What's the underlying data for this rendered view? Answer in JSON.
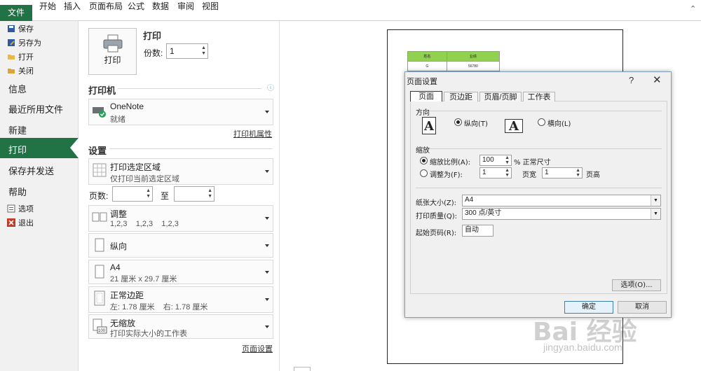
{
  "ribbon": {
    "file_tab": "文件",
    "tabs": [
      "开始",
      "插入",
      "页面布局",
      "公式",
      "数据",
      "审阅",
      "视图"
    ]
  },
  "nav": {
    "save": "保存",
    "save_as": "另存为",
    "open": "打开",
    "close": "关闭",
    "info": "信息",
    "recent": "最近所用文件",
    "new": "新建",
    "print": "打印",
    "save_send": "保存并发送",
    "help": "帮助",
    "options": "选项",
    "exit": "退出"
  },
  "print_panel": {
    "print_heading": "打印",
    "print_button": "打印",
    "copies_label": "份数:",
    "copies_value": "1",
    "printer_heading": "打印机",
    "printer_name": "OneNote",
    "printer_status": "就绪",
    "printer_props": "打印机属性",
    "settings_heading": "设置",
    "area_title": "打印选定区域",
    "area_sub": "仅打印当前选定区域",
    "pages_label": "页数:",
    "pages_to": "至",
    "collate_title": "调整",
    "collate_sub": "1,2,3    1,2,3    1,2,3",
    "orientation": "纵向",
    "paper_title": "A4",
    "paper_sub": "21 厘米 x 29.7 厘米",
    "margin_title": "正常边距",
    "margin_sub": "左: 1.78 厘米    右: 1.78 厘米",
    "scale_title": "无缩放",
    "scale_sub": "打印实际大小的工作表",
    "page_setup_link": "页面设置"
  },
  "preview": {
    "table_headers": [
      "姓名",
      "业绩"
    ],
    "table_rows": [
      [
        "G",
        "56780"
      ]
    ]
  },
  "dialog": {
    "title": "页面设置",
    "help": "?",
    "close": "✕",
    "tabs": [
      "页面",
      "页边距",
      "页眉/页脚",
      "工作表"
    ],
    "orientation_group": "方向",
    "portrait": "纵向(T)",
    "landscape": "横向(L)",
    "scaling_group": "缩放",
    "adjust_to": "缩放比例(A):",
    "adjust_value": "100",
    "adjust_suffix": "% 正常尺寸",
    "fit_to": "调整为(F):",
    "fit_wide_value": "1",
    "fit_wide_label": "页宽",
    "fit_tall_value": "1",
    "fit_tall_label": "页高",
    "paper_size_label": "纸张大小(Z):",
    "paper_size_value": "A4",
    "quality_label": "打印质量(Q):",
    "quality_value": "300 点/英寸",
    "first_page_label": "起始页码(R):",
    "first_page_value": "自动",
    "options_button": "选项(O)...",
    "ok_button": "确定",
    "cancel_button": "取消"
  },
  "watermark": {
    "brand": "Bai 经验",
    "url": "jingyan.baidu.com"
  }
}
